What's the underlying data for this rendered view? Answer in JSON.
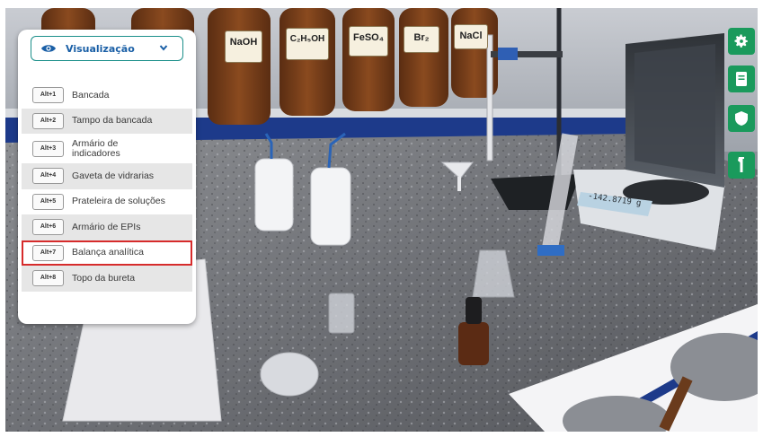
{
  "menu": {
    "dropdown_label": "Visualização",
    "items": [
      {
        "key": "Alt+1",
        "label": "Bancada"
      },
      {
        "key": "Alt+2",
        "label": "Tampo da bancada"
      },
      {
        "key": "Alt+3",
        "label": "Armário de indicadores"
      },
      {
        "key": "Alt+4",
        "label": "Gaveta de vidrarias"
      },
      {
        "key": "Alt+5",
        "label": "Prateleira de soluções"
      },
      {
        "key": "Alt+6",
        "label": "Armário de EPIs"
      },
      {
        "key": "Alt+7",
        "label": "Balança analítica",
        "selected": true
      },
      {
        "key": "Alt+8",
        "label": "Topo da bureta"
      }
    ]
  },
  "toolbar": {
    "buttons": [
      "gear-icon",
      "notebook-icon",
      "shield-icon",
      "flask-icon"
    ],
    "accent": "#1a9a5c"
  },
  "scene": {
    "bottle_labels": [
      "NaOH",
      "C₂H₅OH",
      "FeSO₄",
      "Br₂",
      "NaCl"
    ],
    "balance_display": "-142.8719 g"
  },
  "colors": {
    "teal_border": "#1b8f8a",
    "label_blue": "#1a5fa6",
    "selection_red": "#d62b2b"
  }
}
